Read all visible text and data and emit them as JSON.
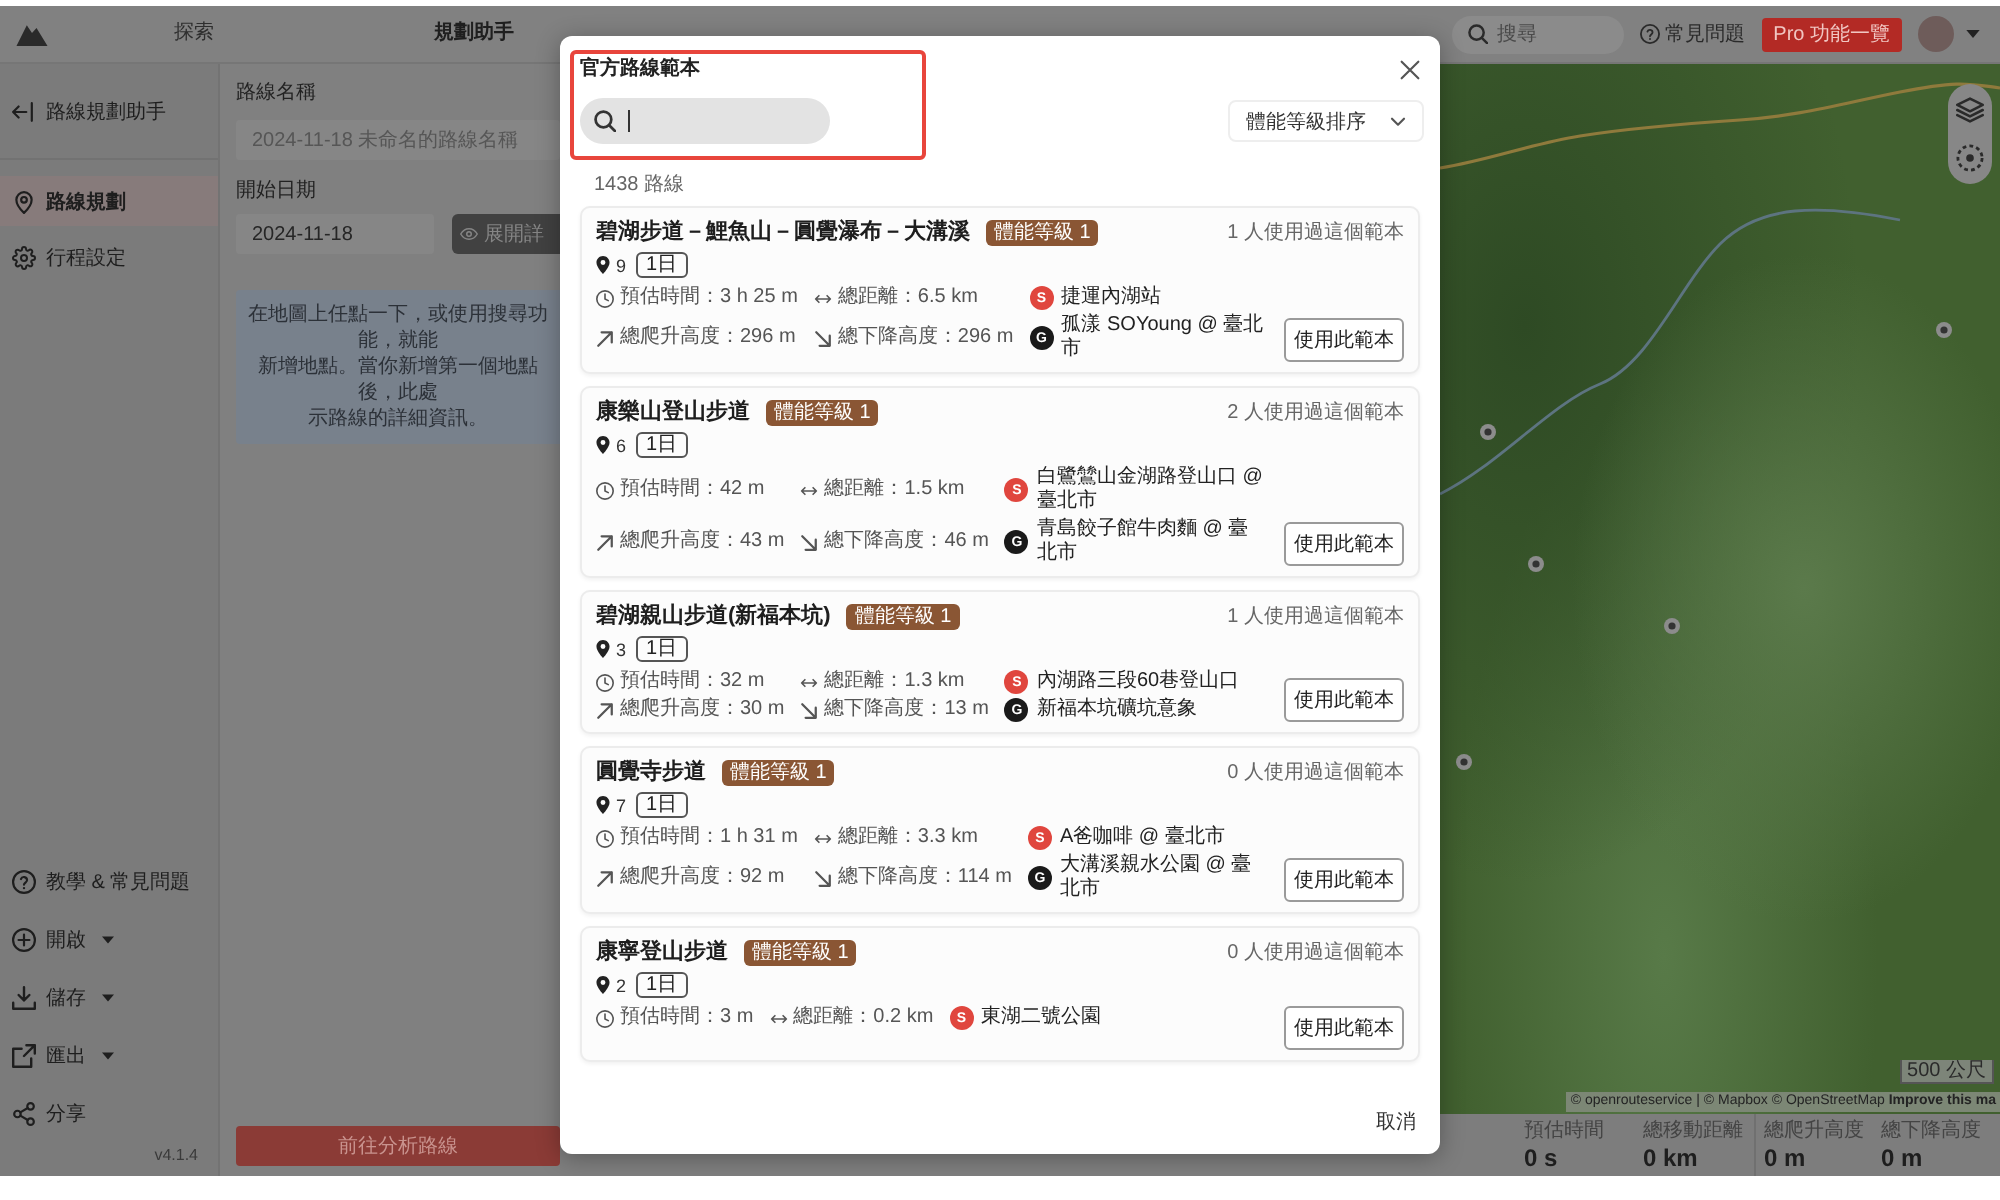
{
  "topbar": {
    "nav": [
      {
        "label": "探索",
        "selected": false
      },
      {
        "label": "規劃助手",
        "selected": true
      }
    ],
    "search": {
      "placeholder": "搜尋"
    },
    "help": "常見問題",
    "pro_button": "Pro 功能一覽"
  },
  "sidebar": {
    "header": "路線規劃助手",
    "items": [
      {
        "kind": "route",
        "label": "路線規劃",
        "selected": true
      },
      {
        "kind": "settings",
        "label": "行程設定",
        "selected": false
      }
    ],
    "bottom_items": [
      {
        "kind": "help",
        "label": "教學 & 常見問題",
        "has_menu": false
      },
      {
        "kind": "open",
        "label": "開啟",
        "has_menu": true
      },
      {
        "kind": "save",
        "label": "儲存",
        "has_menu": true
      },
      {
        "kind": "export",
        "label": "匯出",
        "has_menu": true
      },
      {
        "kind": "share",
        "label": "分享",
        "has_menu": false
      }
    ],
    "version": "v4.1.4"
  },
  "panel": {
    "route_name": {
      "label": "路線名稱",
      "placeholder": "2024-11-18 未命名的路線名稱"
    },
    "start_date": {
      "label": "開始日期",
      "value": "2024-11-18"
    },
    "details_button": "展開詳",
    "info_lines": [
      "在地圖上任點一下，或使用搜尋功能，就能",
      "新增地點。當你新增第一個地點後，此處",
      "示路線的詳細資訊。"
    ],
    "analyze_button": "前往分析路線"
  },
  "map": {
    "scale": "500 公尺",
    "attribution": "© openrouteservice | © Mapbox © OpenStreetMap **Improve this ma**"
  },
  "summary": [
    {
      "label": "預估時間",
      "value": "0 s"
    },
    {
      "label": "總移動距離",
      "value": "0 km"
    },
    {
      "label": "總爬升高度",
      "value": "0 m"
    },
    {
      "label": "總下降高度",
      "value": "0 m"
    }
  ],
  "modal": {
    "title": "官方路線範本",
    "highlight": true,
    "search": {
      "focused": true
    },
    "sort": "體能等級排序",
    "count": "1438 路線",
    "cancel": "取消",
    "routes": [
      {
        "title": "碧湖步道－鯉魚山－圓覺瀑布－大溝溪",
        "level": "體能等級 1",
        "usage": "1 人使用過這個範本",
        "stops": "9",
        "days": "1日",
        "stats": [
          {
            "kind": "time",
            "text": "預估時間：3 h 25 m"
          },
          {
            "kind": "distance",
            "text": "總距離：6.5 km"
          },
          {
            "kind": "ascent",
            "text": "總爬升高度：296 m"
          },
          {
            "kind": "descent",
            "text": "總下降高度：296 m"
          }
        ],
        "points": [
          {
            "kind": "start",
            "mark": "S",
            "place": "捷運內湖站"
          },
          {
            "kind": "end",
            "mark": "G",
            "place": "孤漾 SOYoung @ 臺北市"
          }
        ],
        "action": "使用此範本"
      },
      {
        "title": "康樂山登山步道",
        "level": "體能等級 1",
        "usage": "2 人使用過這個範本",
        "stops": "6",
        "days": "1日",
        "stats": [
          {
            "kind": "time",
            "text": "預估時間：42 m"
          },
          {
            "kind": "distance",
            "text": "總距離：1.5 km"
          },
          {
            "kind": "ascent",
            "text": "總爬升高度：43 m"
          },
          {
            "kind": "descent",
            "text": "總下降高度：46 m"
          }
        ],
        "points": [
          {
            "kind": "start",
            "mark": "S",
            "place": "白鷺鷥山金湖路登山口 @ 臺北市"
          },
          {
            "kind": "end",
            "mark": "G",
            "place": "青島餃子館牛肉麵 @ 臺北市"
          }
        ],
        "action": "使用此範本"
      },
      {
        "title": "碧湖親山步道(新福本坑)",
        "level": "體能等級 1",
        "usage": "1 人使用過這個範本",
        "stops": "3",
        "days": "1日",
        "stats": [
          {
            "kind": "time",
            "text": "預估時間：32 m"
          },
          {
            "kind": "distance",
            "text": "總距離：1.3 km"
          },
          {
            "kind": "ascent",
            "text": "總爬升高度：30 m"
          },
          {
            "kind": "descent",
            "text": "總下降高度：13 m"
          }
        ],
        "points": [
          {
            "kind": "start",
            "mark": "S",
            "place": "內湖路三段60巷登山口"
          },
          {
            "kind": "end",
            "mark": "G",
            "place": "新福本坑礦坑意象"
          }
        ],
        "action": "使用此範本"
      },
      {
        "title": "圓覺寺步道",
        "level": "體能等級 1",
        "usage": "0 人使用過這個範本",
        "stops": "7",
        "days": "1日",
        "stats": [
          {
            "kind": "time",
            "text": "預估時間：1 h 31 m"
          },
          {
            "kind": "distance",
            "text": "總距離：3.3 km"
          },
          {
            "kind": "ascent",
            "text": "總爬升高度：92 m"
          },
          {
            "kind": "descent",
            "text": "總下降高度：114 m"
          }
        ],
        "points": [
          {
            "kind": "start",
            "mark": "S",
            "place": "A爸咖啡 @ 臺北市"
          },
          {
            "kind": "end",
            "mark": "G",
            "place": "大溝溪親水公園 @ 臺北市"
          }
        ],
        "action": "使用此範本"
      },
      {
        "title": "康寧登山步道",
        "level": "體能等級 1",
        "usage": "0 人使用過這個範本",
        "stops": "2",
        "days": "1日",
        "stats": [
          {
            "kind": "time",
            "text": "預估時間：3 m"
          },
          {
            "kind": "distance",
            "text": "總距離：0.2 km"
          }
        ],
        "points": [
          {
            "kind": "start",
            "mark": "S",
            "place": "東湖二號公園"
          }
        ],
        "action": "使用此範本"
      }
    ]
  }
}
